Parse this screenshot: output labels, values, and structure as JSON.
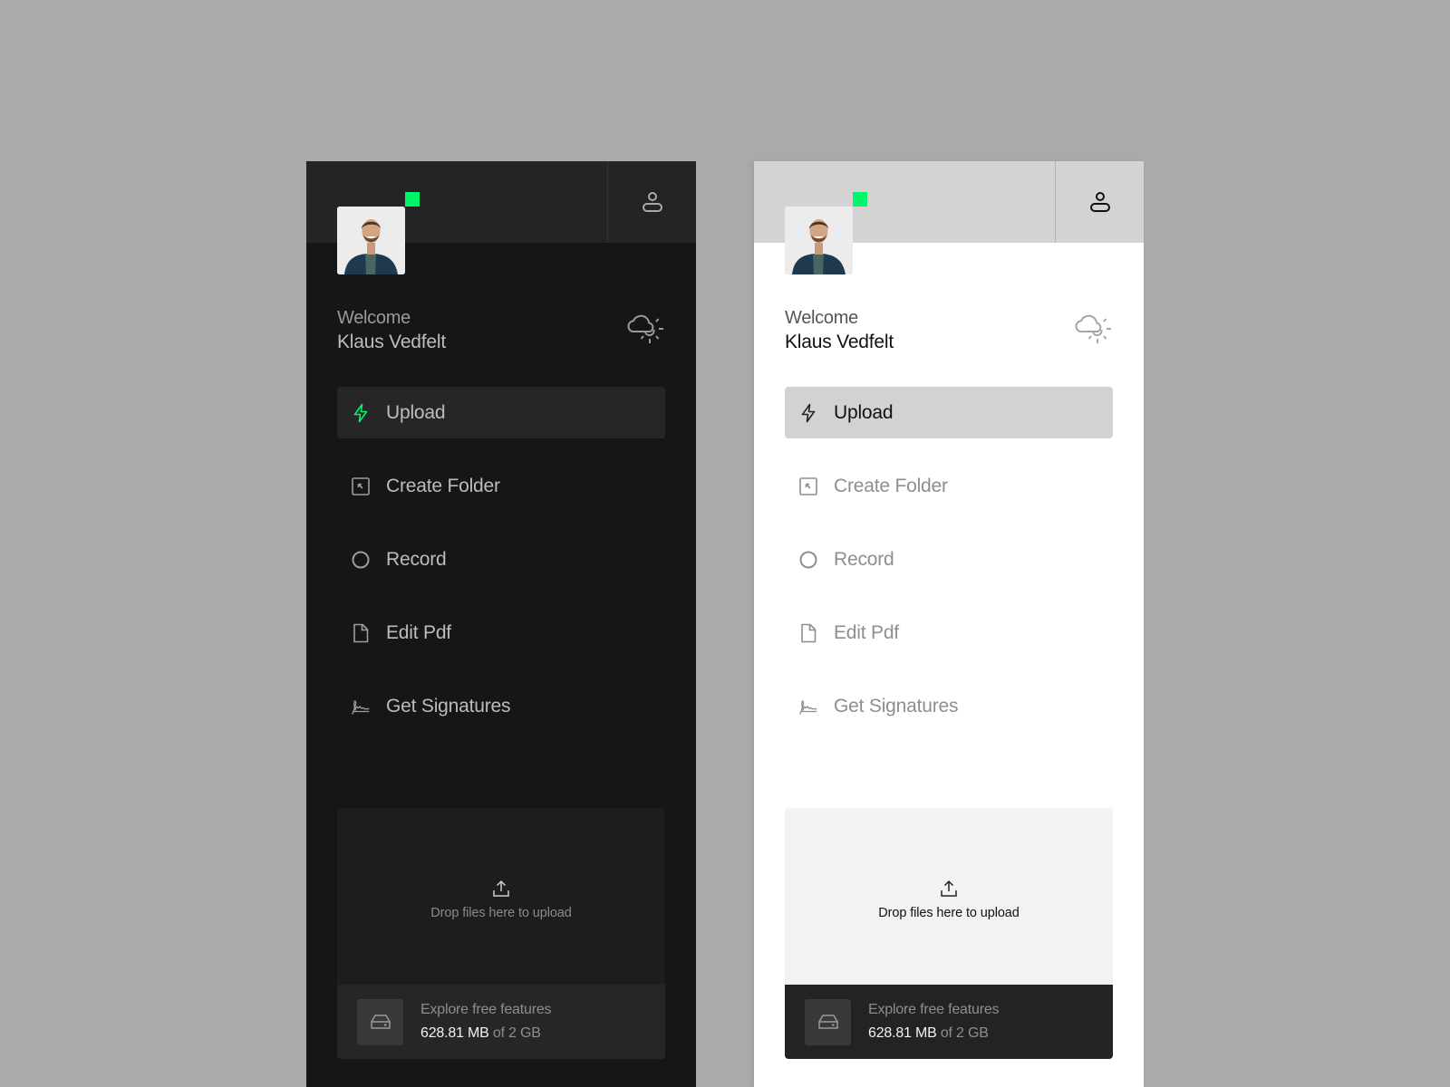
{
  "accent_color": "#00f56a",
  "panels": [
    {
      "theme": "dark",
      "user": {
        "greeting": "Welcome",
        "name": "Klaus Vedfelt",
        "status": "online"
      },
      "header": {
        "profile_icon": "user-icon",
        "weather_icon": "partly-cloudy-icon"
      },
      "menu": [
        {
          "label": "Upload",
          "icon": "lightning-icon",
          "active": true
        },
        {
          "label": "Create Folder",
          "icon": "folder-arrow-icon",
          "active": false
        },
        {
          "label": "Record",
          "icon": "circle-icon",
          "active": false
        },
        {
          "label": "Edit Pdf",
          "icon": "document-icon",
          "active": false
        },
        {
          "label": "Get Signatures",
          "icon": "signature-icon",
          "active": false
        }
      ],
      "dropzone": {
        "icon": "upload-icon",
        "text": "Drop files here to upload"
      },
      "storage": {
        "icon": "hard-drive-icon",
        "title": "Explore free features",
        "used": "628.81 MB",
        "total": "of 2 GB"
      }
    },
    {
      "theme": "light",
      "user": {
        "greeting": "Welcome",
        "name": "Klaus Vedfelt",
        "status": "online"
      },
      "header": {
        "profile_icon": "user-icon",
        "weather_icon": "partly-cloudy-icon"
      },
      "menu": [
        {
          "label": "Upload",
          "icon": "lightning-icon",
          "active": true
        },
        {
          "label": "Create Folder",
          "icon": "folder-arrow-icon",
          "active": false
        },
        {
          "label": "Record",
          "icon": "circle-icon",
          "active": false
        },
        {
          "label": "Edit Pdf",
          "icon": "document-icon",
          "active": false
        },
        {
          "label": "Get Signatures",
          "icon": "signature-icon",
          "active": false
        }
      ],
      "dropzone": {
        "icon": "upload-icon",
        "text": "Drop files here to upload"
      },
      "storage": {
        "icon": "hard-drive-icon",
        "title": "Explore free features",
        "used": "628.81 MB",
        "total": "of 2 GB"
      }
    }
  ]
}
